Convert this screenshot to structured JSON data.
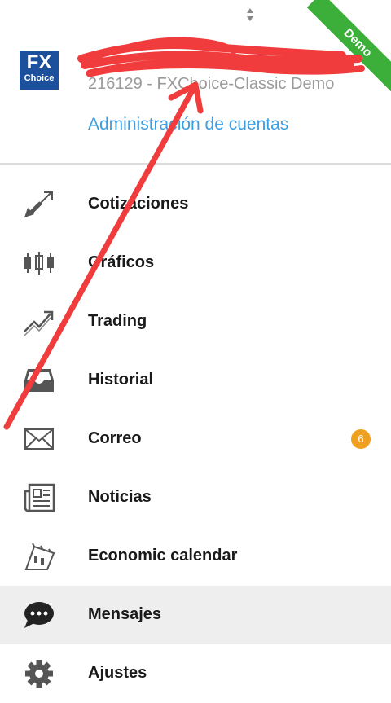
{
  "header": {
    "logo_fx": "FX",
    "logo_choice": "Choice",
    "account_name": "F",
    "account_sub": "216129 - FXChoice-Classic Demo",
    "admin_link": "Administración de cuentas",
    "demo_badge": "Demo"
  },
  "menu": {
    "items": [
      {
        "label": "Cotizaciones",
        "icon": "quotes-arrows-icon"
      },
      {
        "label": "Gráficos",
        "icon": "candlestick-chart-icon"
      },
      {
        "label": "Trading",
        "icon": "trading-trend-icon"
      },
      {
        "label": "Historial",
        "icon": "inbox-tray-icon"
      },
      {
        "label": "Correo",
        "icon": "mail-envelope-icon",
        "badge": "6"
      },
      {
        "label": "Noticias",
        "icon": "newspaper-icon"
      },
      {
        "label": "Economic calendar",
        "icon": "calendar-icon"
      },
      {
        "label": "Mensajes",
        "icon": "chat-bubble-icon",
        "active": true
      },
      {
        "label": "Ajustes",
        "icon": "gear-icon"
      }
    ]
  },
  "colors": {
    "link": "#3d9ee0",
    "demo_ribbon": "#3cae3a",
    "badge": "#f0a020",
    "annotation": "#f03c3c",
    "logo": "#1c4f9c"
  }
}
